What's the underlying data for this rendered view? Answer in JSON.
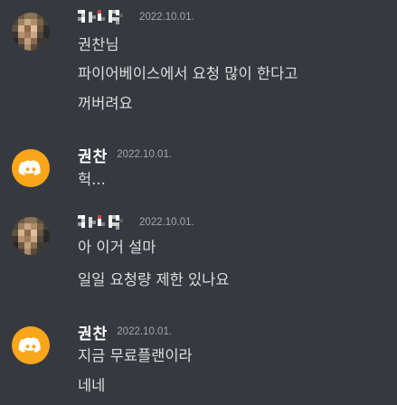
{
  "colors": {
    "background": "#36393f",
    "username": "#ffffff",
    "message": "#dcddde",
    "timestamp": "#a3a6aa",
    "discord_avatar": "#faa61a"
  },
  "messages": [
    {
      "author": "",
      "avatar": "mosaic-photo-avatar",
      "timestamp": "2022.10.01.",
      "lines": [
        "권찬님",
        "파이어베이스에서 요청 많이 한다고",
        "꺼버려요"
      ]
    },
    {
      "author": "권찬",
      "avatar": "discord-logo-avatar",
      "timestamp": "2022.10.01.",
      "lines": [
        "헉..."
      ]
    },
    {
      "author": "",
      "avatar": "mosaic-photo-avatar",
      "timestamp": "2022.10.01.",
      "lines": [
        "아 이거 설마",
        "일일 요청량 제한 있나요"
      ]
    },
    {
      "author": "권찬",
      "avatar": "discord-logo-avatar",
      "timestamp": "2022.10.01.",
      "lines": [
        "지금 무료플랜이라",
        "네네"
      ]
    }
  ]
}
